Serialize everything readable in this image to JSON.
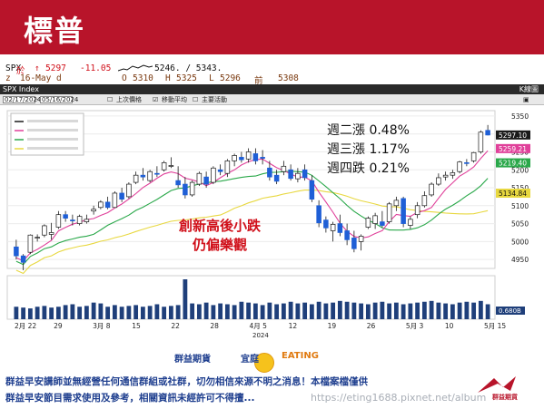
{
  "banner": {
    "title": "標普"
  },
  "terminal": {
    "symbol": "SPX",
    "last_marker": "↑",
    "last": "5297",
    "change": "-11.05",
    "range_text": "5246. / 5343.",
    "date_label": "16-May d",
    "open_label": "O",
    "open": "5310",
    "high_label": "H",
    "high": "5325",
    "low_label": "L",
    "low": "5296",
    "prev_label": "前",
    "prev": "5308",
    "row1_hint": "於",
    "row2_mark": "z"
  },
  "toolbar": {
    "title": "SPX Index",
    "right": "K線圖"
  },
  "toolbar2": {
    "start_date": "02/17/2024",
    "end_date": "05/16/2024",
    "item1": "上次價格",
    "item2": "移動平均",
    "item3": "主要活動"
  },
  "chart_data": {
    "type": "candlestick",
    "colors": {
      "up": "#ffffff",
      "down": "#1f5fd6",
      "ma1": "#e0409a",
      "ma2": "#2aa84a",
      "ma3": "#e8d840",
      "volume": "#1f3f7a"
    },
    "price_axis": {
      "ticks": [
        4950,
        5000,
        5050,
        5100,
        5150,
        5200,
        5250,
        5300,
        5350
      ],
      "ylim": [
        4925,
        5365
      ]
    },
    "tags": [
      {
        "label": "5297.10",
        "value": 5297.1,
        "color": "#1a1a1a"
      },
      {
        "label": "5259.21",
        "value": 5259.21,
        "color": "#e0409a"
      },
      {
        "label": "5219.40",
        "value": 5219.4,
        "color": "#2aa84a"
      },
      {
        "label": "5134.84",
        "value": 5134.84,
        "color": "#e8d840"
      }
    ],
    "x_labels": [
      "2月 22",
      "29",
      "3月 8",
      "15",
      "22",
      "28",
      "4月 5",
      "12",
      "19",
      "26",
      "5月 3",
      "10",
      "5月 15"
    ],
    "x_year": "2024",
    "volume_tag": "0.680B",
    "candles": [
      [
        4985,
        5005,
        4950,
        4960
      ],
      [
        4960,
        4965,
        4920,
        4942
      ],
      [
        4970,
        5020,
        4965,
        5018
      ],
      [
        5012,
        5020,
        5000,
        5012
      ],
      [
        5018,
        5048,
        5012,
        5044
      ],
      [
        5020,
        5052,
        5005,
        5025
      ],
      [
        5040,
        5085,
        5035,
        5075
      ],
      [
        5075,
        5085,
        5055,
        5065
      ],
      [
        5060,
        5075,
        5045,
        5058
      ],
      [
        5050,
        5075,
        5045,
        5070
      ],
      [
        5055,
        5075,
        5050,
        5062
      ],
      [
        5085,
        5100,
        5075,
        5090
      ],
      [
        5095,
        5115,
        5090,
        5110
      ],
      [
        5110,
        5125,
        5090,
        5095
      ],
      [
        5095,
        5140,
        5095,
        5135
      ],
      [
        5135,
        5150,
        5110,
        5118
      ],
      [
        5125,
        5165,
        5120,
        5160
      ],
      [
        5165,
        5195,
        5160,
        5185
      ],
      [
        5185,
        5205,
        5170,
        5180
      ],
      [
        5170,
        5200,
        5165,
        5195
      ],
      [
        5190,
        5210,
        5180,
        5188
      ],
      [
        5200,
        5225,
        5195,
        5220
      ],
      [
        5210,
        5235,
        5205,
        5212
      ],
      [
        5170,
        5210,
        5150,
        5158
      ],
      [
        5160,
        5180,
        5120,
        5130
      ],
      [
        5130,
        5170,
        5125,
        5165
      ],
      [
        5160,
        5195,
        5155,
        5190
      ],
      [
        5180,
        5195,
        5150,
        5160
      ],
      [
        5165,
        5210,
        5160,
        5205
      ],
      [
        5200,
        5215,
        5185,
        5195
      ],
      [
        5190,
        5230,
        5180,
        5225
      ],
      [
        5225,
        5245,
        5210,
        5240
      ],
      [
        5235,
        5250,
        5220,
        5228
      ],
      [
        5230,
        5260,
        5220,
        5250
      ],
      [
        5245,
        5260,
        5215,
        5225
      ],
      [
        5235,
        5255,
        5215,
        5232
      ],
      [
        5205,
        5225,
        5170,
        5180
      ],
      [
        5185,
        5200,
        5160,
        5168
      ],
      [
        5195,
        5225,
        5185,
        5210
      ],
      [
        5200,
        5215,
        5170,
        5176
      ],
      [
        5175,
        5205,
        5165,
        5190
      ],
      [
        5200,
        5215,
        5170,
        5178
      ],
      [
        5170,
        5185,
        5110,
        5118
      ],
      [
        5100,
        5115,
        5040,
        5052
      ],
      [
        5060,
        5070,
        5025,
        5038
      ],
      [
        5030,
        5055,
        5000,
        5048
      ],
      [
        5050,
        5075,
        5015,
        5025
      ],
      [
        5030,
        5050,
        4990,
        5005
      ],
      [
        5010,
        5030,
        4970,
        4980
      ],
      [
        5000,
        5020,
        4975,
        5015
      ],
      [
        5040,
        5070,
        5035,
        5065
      ],
      [
        5050,
        5080,
        5035,
        5072
      ],
      [
        5055,
        5085,
        5040,
        5045
      ],
      [
        5055,
        5110,
        5050,
        5105
      ],
      [
        5100,
        5125,
        5085,
        5115
      ],
      [
        5120,
        5125,
        5040,
        5050
      ],
      [
        5045,
        5070,
        5035,
        5062
      ],
      [
        5075,
        5110,
        5065,
        5100
      ],
      [
        5100,
        5140,
        5095,
        5128
      ],
      [
        5130,
        5165,
        5125,
        5160
      ],
      [
        5160,
        5190,
        5155,
        5178
      ],
      [
        5180,
        5195,
        5170,
        5185
      ],
      [
        5185,
        5200,
        5175,
        5192
      ],
      [
        5195,
        5225,
        5190,
        5222
      ],
      [
        5220,
        5230,
        5210,
        5218
      ],
      [
        5225,
        5250,
        5220,
        5248
      ],
      [
        5250,
        5310,
        5245,
        5305
      ],
      [
        5310,
        5325,
        5296,
        5297
      ]
    ],
    "volume": [
      30,
      28,
      26,
      30,
      32,
      28,
      30,
      34,
      36,
      30,
      32,
      40,
      38,
      30,
      34,
      30,
      32,
      34,
      30,
      32,
      36,
      30,
      32,
      34,
      96,
      38,
      36,
      40,
      34,
      38,
      36,
      34,
      42,
      40,
      38,
      34,
      40,
      36,
      38,
      42,
      38,
      40,
      36,
      42,
      38,
      40,
      44,
      42,
      40,
      38,
      36,
      40,
      42,
      38,
      40,
      36,
      38,
      40,
      42,
      44,
      40,
      38,
      36,
      40,
      42,
      40,
      44,
      36
    ]
  },
  "annotations": {
    "gains": [
      "週二漲 0.48%",
      "週三漲 1.17%",
      "週四跌 0.21%"
    ],
    "comment_line1": "創新高後小跌",
    "comment_line2": "仍偏樂觀"
  },
  "footer": {
    "line1": "群益早安講師並無經營任何通信群組或社群，切勿相信來源不明之消息！本檔案檔僅供",
    "line2": "群益早安節目需求使用及參考，相關資訊未經許可不得擅...",
    "brand": "群益期貨",
    "brand2": "宜庭",
    "brand_eng": "EATING",
    "watermark": "https://eting1688.pixnet.net/album",
    "logo_text": "群益期貨"
  }
}
